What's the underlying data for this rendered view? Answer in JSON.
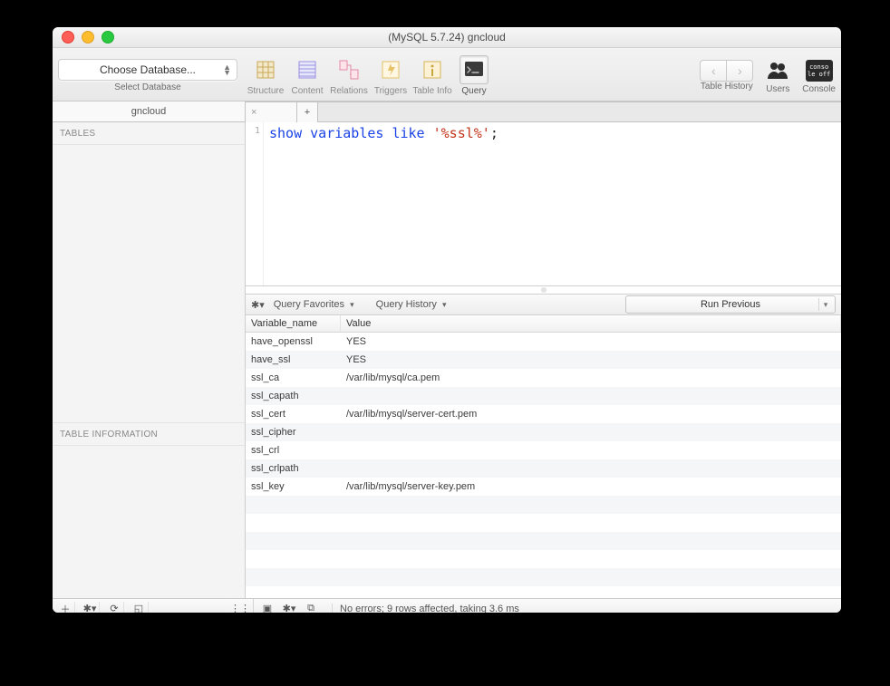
{
  "window": {
    "title": "(MySQL 5.7.24) gncloud"
  },
  "toolbar": {
    "db_select_label": "Choose Database...",
    "db_group_label": "Select Database",
    "tools": {
      "structure": "Structure",
      "content": "Content",
      "relations": "Relations",
      "triggers": "Triggers",
      "table_info": "Table Info",
      "query": "Query"
    },
    "right": {
      "history": "Table History",
      "users": "Users",
      "console": "Console",
      "console_line1": "conso",
      "console_line2": "le off"
    }
  },
  "tabs": {
    "main": "gncloud",
    "add": "+"
  },
  "sidebar": {
    "tables_header": "TABLES",
    "info_header": "TABLE INFORMATION"
  },
  "editor": {
    "line_no": "1",
    "kw1": "show",
    "kw2": "variables",
    "kw3": "like",
    "str": "'%ssl%'",
    "semi": ";"
  },
  "qbar": {
    "favorites": "Query Favorites",
    "history": "Query History",
    "run": "Run Previous"
  },
  "results": {
    "columns": [
      "Variable_name",
      "Value"
    ],
    "rows": [
      {
        "k": "have_openssl",
        "v": "YES"
      },
      {
        "k": "have_ssl",
        "v": "YES"
      },
      {
        "k": "ssl_ca",
        "v": "/var/lib/mysql/ca.pem"
      },
      {
        "k": "ssl_capath",
        "v": ""
      },
      {
        "k": "ssl_cert",
        "v": "/var/lib/mysql/server-cert.pem"
      },
      {
        "k": "ssl_cipher",
        "v": ""
      },
      {
        "k": "ssl_crl",
        "v": ""
      },
      {
        "k": "ssl_crlpath",
        "v": ""
      },
      {
        "k": "ssl_key",
        "v": "/var/lib/mysql/server-key.pem"
      }
    ]
  },
  "status": {
    "message": "No errors; 9 rows affected, taking 3.6 ms"
  }
}
